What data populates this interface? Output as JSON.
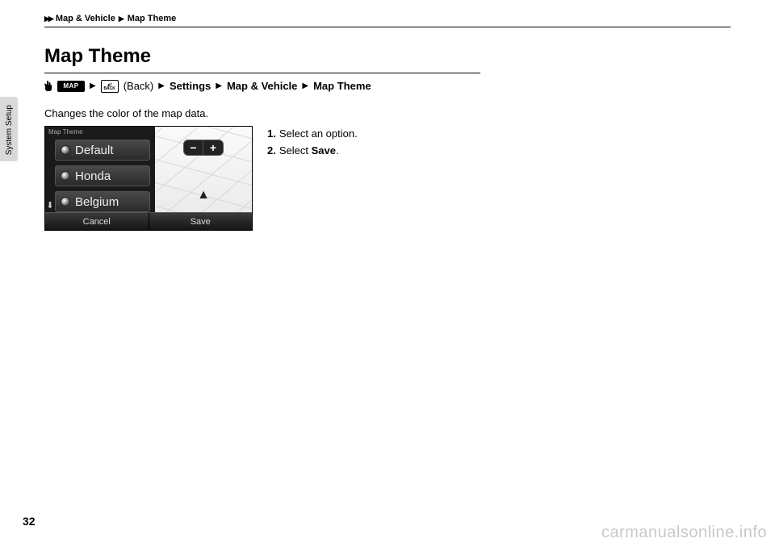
{
  "breadcrumb": {
    "level1": "Map & Vehicle",
    "level2": "Map Theme"
  },
  "title": "Map Theme",
  "nav_path": {
    "map_btn": "MAP",
    "back_label": "BACK",
    "back_text": "(Back)",
    "s1": "Settings",
    "s2": "Map & Vehicle",
    "s3": "Map Theme"
  },
  "description": "Changes the color of the map data.",
  "screenshot": {
    "header": "Map Theme",
    "options": [
      "Default",
      "Honda",
      "Belgium"
    ],
    "zoom_minus": "−",
    "zoom_plus": "+",
    "btn_cancel": "Cancel",
    "btn_save": "Save"
  },
  "steps": [
    {
      "n": "1.",
      "text": "Select an option."
    },
    {
      "n": "2.",
      "text_pre": "Select ",
      "emph": "Save",
      "text_post": "."
    }
  ],
  "side_label": "System Setup",
  "page_number": "32",
  "watermark": "carmanualsonline.info"
}
